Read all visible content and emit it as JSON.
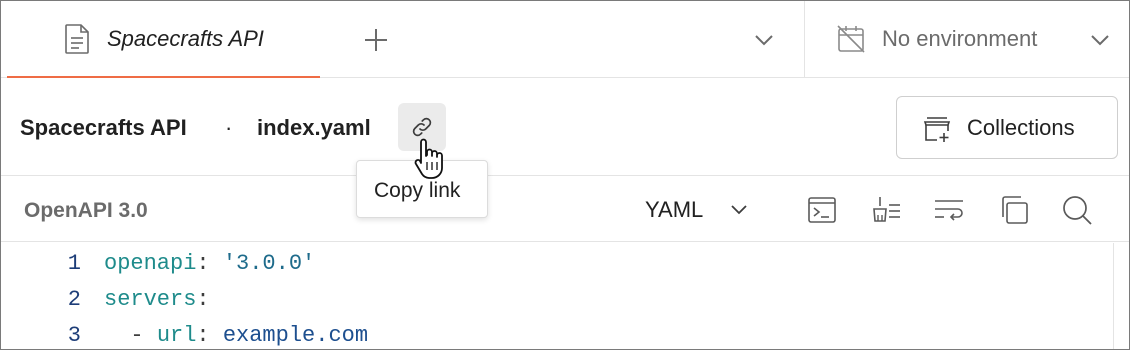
{
  "tab": {
    "title": "Spacecrafts API",
    "icon": "document-icon",
    "accent": "#ef6c45"
  },
  "environment": {
    "label": "No environment",
    "icon": "no-environment-icon"
  },
  "header": {
    "api_name": "Spacecrafts API",
    "separator": "·",
    "file_name": "index.yaml",
    "collections_label": "Collections"
  },
  "tooltip": {
    "text": "Copy link"
  },
  "toolbar": {
    "spec_label": "OpenAPI 3.0",
    "format": "YAML",
    "tools": [
      "terminal-icon",
      "beautify-icon",
      "wrap-lines-icon",
      "copy-icon",
      "search-icon"
    ]
  },
  "editor": {
    "lines": [
      {
        "num": "1",
        "key": "openapi",
        "sep": ": ",
        "value": "'3.0.0'",
        "indent": ""
      },
      {
        "num": "2",
        "key": "servers",
        "sep": ":",
        "value": "",
        "indent": ""
      },
      {
        "num": "3",
        "key": "url",
        "sep": ": ",
        "value": "example.com",
        "indent": "  - "
      }
    ]
  }
}
